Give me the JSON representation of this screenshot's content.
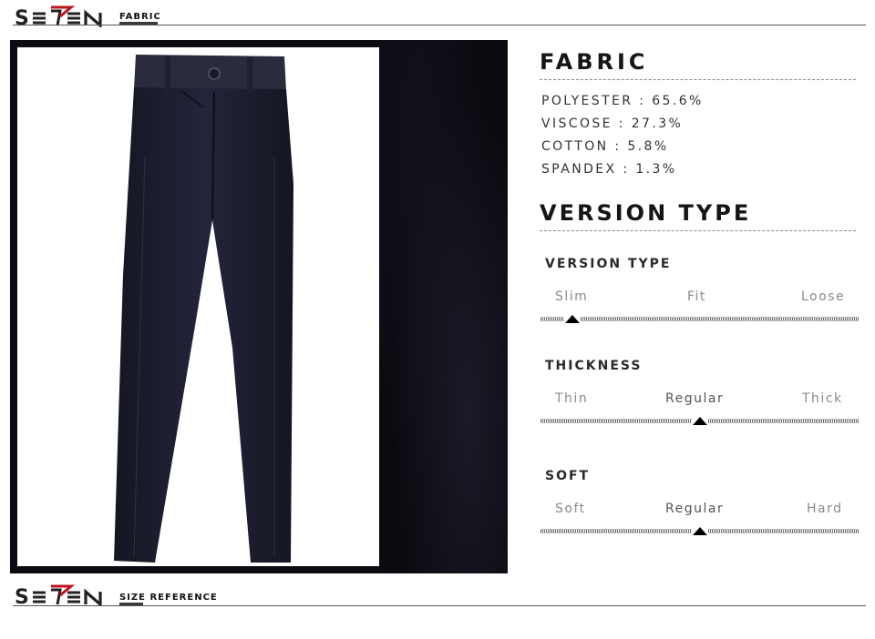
{
  "brand": {
    "logo_text": "SEVEN"
  },
  "header_top": {
    "label": "FABRIC"
  },
  "header_bottom": {
    "label": "SIZE REFERENCE"
  },
  "fabric": {
    "title": "FABRIC",
    "items": [
      "POLYESTER : 65.6%",
      "VISCOSE : 27.3%",
      "COTTON : 5.8%",
      "SPANDEX : 1.3%"
    ]
  },
  "version": {
    "title": "VERSION TYPE",
    "params": [
      {
        "title": "VERSION TYPE",
        "options": [
          "Slim",
          "Fit",
          "Loose"
        ],
        "selected_fraction": 0.1
      },
      {
        "title": "THICKNESS",
        "options": [
          "Thin",
          "Regular",
          "Thick"
        ],
        "selected_fraction": 0.5
      },
      {
        "title": "SOFT",
        "options": [
          "Soft",
          "Regular",
          "Hard"
        ],
        "selected_fraction": 0.5
      }
    ]
  },
  "colors": {
    "accent": "#c0121f",
    "text": "#151515",
    "garment": "#1c1d2c"
  }
}
